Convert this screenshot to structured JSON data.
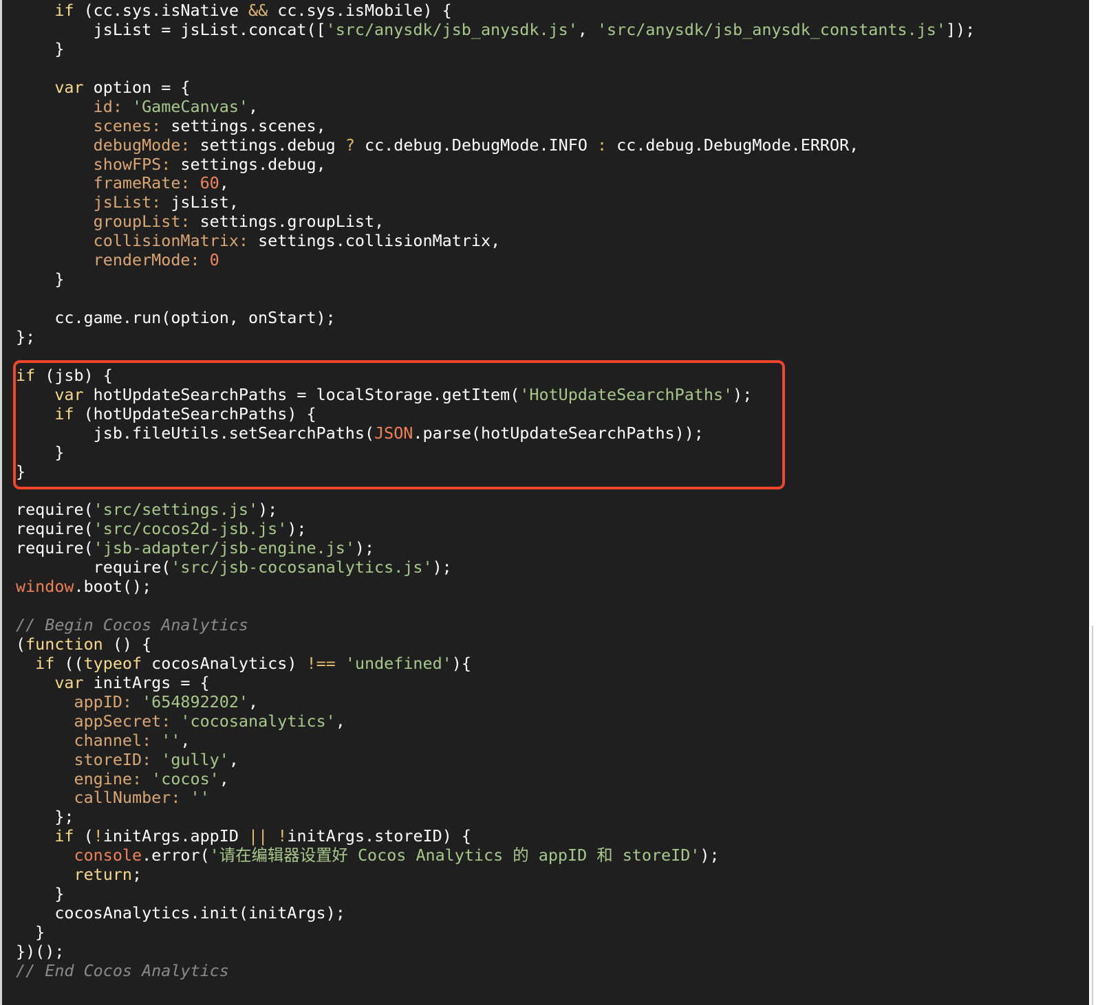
{
  "editor": {
    "theme_colors": {
      "background": "#1f1f1f",
      "keyword": "#f7d98a",
      "string": "#a8c88a",
      "property": "#d9a673",
      "number": "#f08560",
      "global": "#ef8058",
      "comment": "#8a8a8a",
      "highlight_border": "#f2452b"
    },
    "lines": [
      [
        {
          "t": "    "
        },
        {
          "t": "if",
          "c": "kw"
        },
        {
          "t": " (cc.sys.isNative "
        },
        {
          "t": "&&",
          "c": "op"
        },
        {
          "t": " cc.sys.isMobile) {"
        }
      ],
      [
        {
          "t": "        jsList = jsList.concat(["
        },
        {
          "t": "'src/anysdk/jsb_anysdk.js'",
          "c": "str"
        },
        {
          "t": ", "
        },
        {
          "t": "'src/anysdk/jsb_anysdk_constants.js'",
          "c": "str"
        },
        {
          "t": "]);"
        }
      ],
      [
        {
          "t": "    }"
        }
      ],
      [
        {
          "t": ""
        }
      ],
      [
        {
          "t": "    "
        },
        {
          "t": "var",
          "c": "kw"
        },
        {
          "t": " option = {"
        }
      ],
      [
        {
          "t": "        "
        },
        {
          "t": "id",
          "c": "prop"
        },
        {
          "t": ": ",
          "c": "prop"
        },
        {
          "t": "'GameCanvas'",
          "c": "str"
        },
        {
          "t": ","
        }
      ],
      [
        {
          "t": "        "
        },
        {
          "t": "scenes",
          "c": "prop"
        },
        {
          "t": ": ",
          "c": "prop"
        },
        {
          "t": "settings.scenes,"
        }
      ],
      [
        {
          "t": "        "
        },
        {
          "t": "debugMode",
          "c": "prop"
        },
        {
          "t": ": ",
          "c": "prop"
        },
        {
          "t": "settings.debug "
        },
        {
          "t": "?",
          "c": "op"
        },
        {
          "t": " cc.debug.DebugMode.INFO "
        },
        {
          "t": ":",
          "c": "op"
        },
        {
          "t": " cc.debug.DebugMode.ERROR,"
        }
      ],
      [
        {
          "t": "        "
        },
        {
          "t": "showFPS",
          "c": "prop"
        },
        {
          "t": ": ",
          "c": "prop"
        },
        {
          "t": "settings.debug,"
        }
      ],
      [
        {
          "t": "        "
        },
        {
          "t": "frameRate",
          "c": "prop"
        },
        {
          "t": ": ",
          "c": "prop"
        },
        {
          "t": "60",
          "c": "num"
        },
        {
          "t": ","
        }
      ],
      [
        {
          "t": "        "
        },
        {
          "t": "jsList",
          "c": "prop"
        },
        {
          "t": ": ",
          "c": "prop"
        },
        {
          "t": "jsList,"
        }
      ],
      [
        {
          "t": "        "
        },
        {
          "t": "groupList",
          "c": "prop"
        },
        {
          "t": ": ",
          "c": "prop"
        },
        {
          "t": "settings.groupList,"
        }
      ],
      [
        {
          "t": "        "
        },
        {
          "t": "collisionMatrix",
          "c": "prop"
        },
        {
          "t": ": ",
          "c": "prop"
        },
        {
          "t": "settings.collisionMatrix,"
        }
      ],
      [
        {
          "t": "        "
        },
        {
          "t": "renderMode",
          "c": "prop"
        },
        {
          "t": ": ",
          "c": "prop"
        },
        {
          "t": "0",
          "c": "num"
        }
      ],
      [
        {
          "t": "    }"
        }
      ],
      [
        {
          "t": ""
        }
      ],
      [
        {
          "t": "    cc.game.run(option, onStart);"
        }
      ],
      [
        {
          "t": "};"
        }
      ],
      [
        {
          "t": ""
        }
      ],
      [
        {
          "t": "if",
          "c": "kw"
        },
        {
          "t": " (jsb) {"
        }
      ],
      [
        {
          "t": "    "
        },
        {
          "t": "var",
          "c": "kw"
        },
        {
          "t": " hotUpdateSearchPaths = localStorage.getItem("
        },
        {
          "t": "'HotUpdateSearchPaths'",
          "c": "str"
        },
        {
          "t": ");"
        }
      ],
      [
        {
          "t": "    "
        },
        {
          "t": "if",
          "c": "kw"
        },
        {
          "t": " (hotUpdateSearchPaths) {"
        }
      ],
      [
        {
          "t": "        jsb.fileUtils.setSearchPaths("
        },
        {
          "t": "JSON",
          "c": "glob"
        },
        {
          "t": ".parse(hotUpdateSearchPaths));"
        }
      ],
      [
        {
          "t": "    }"
        }
      ],
      [
        {
          "t": "}"
        }
      ],
      [
        {
          "t": ""
        }
      ],
      [
        {
          "t": "require("
        },
        {
          "t": "'src/settings.js'",
          "c": "str"
        },
        {
          "t": ");"
        }
      ],
      [
        {
          "t": "require("
        },
        {
          "t": "'src/cocos2d-jsb.js'",
          "c": "str"
        },
        {
          "t": ");"
        }
      ],
      [
        {
          "t": "require("
        },
        {
          "t": "'jsb-adapter/jsb-engine.js'",
          "c": "str"
        },
        {
          "t": ");"
        }
      ],
      [
        {
          "t": "        require("
        },
        {
          "t": "'src/jsb-cocosanalytics.js'",
          "c": "str"
        },
        {
          "t": ");"
        }
      ],
      [
        {
          "t": "window",
          "c": "glob"
        },
        {
          "t": ".boot();"
        }
      ],
      [
        {
          "t": ""
        }
      ],
      [
        {
          "t": "// Begin Cocos Analytics",
          "c": "cmt"
        }
      ],
      [
        {
          "t": "("
        },
        {
          "t": "function",
          "c": "kw"
        },
        {
          "t": " () {"
        }
      ],
      [
        {
          "t": "  "
        },
        {
          "t": "if",
          "c": "kw"
        },
        {
          "t": " (("
        },
        {
          "t": "typeof",
          "c": "kw"
        },
        {
          "t": " cocosAnalytics) "
        },
        {
          "t": "!==",
          "c": "op"
        },
        {
          "t": " "
        },
        {
          "t": "'undefined'",
          "c": "str"
        },
        {
          "t": "){"
        }
      ],
      [
        {
          "t": "    "
        },
        {
          "t": "var",
          "c": "kw"
        },
        {
          "t": " initArgs = {"
        }
      ],
      [
        {
          "t": "      "
        },
        {
          "t": "appID",
          "c": "prop"
        },
        {
          "t": ": ",
          "c": "prop"
        },
        {
          "t": "'654892202'",
          "c": "str"
        },
        {
          "t": ","
        }
      ],
      [
        {
          "t": "      "
        },
        {
          "t": "appSecret",
          "c": "prop"
        },
        {
          "t": ": ",
          "c": "prop"
        },
        {
          "t": "'cocosanalytics'",
          "c": "str"
        },
        {
          "t": ","
        }
      ],
      [
        {
          "t": "      "
        },
        {
          "t": "channel",
          "c": "prop"
        },
        {
          "t": ": ",
          "c": "prop"
        },
        {
          "t": "''",
          "c": "str"
        },
        {
          "t": ","
        }
      ],
      [
        {
          "t": "      "
        },
        {
          "t": "storeID",
          "c": "prop"
        },
        {
          "t": ": ",
          "c": "prop"
        },
        {
          "t": "'gully'",
          "c": "str"
        },
        {
          "t": ","
        }
      ],
      [
        {
          "t": "      "
        },
        {
          "t": "engine",
          "c": "prop"
        },
        {
          "t": ": ",
          "c": "prop"
        },
        {
          "t": "'cocos'",
          "c": "str"
        },
        {
          "t": ","
        }
      ],
      [
        {
          "t": "      "
        },
        {
          "t": "callNumber",
          "c": "prop"
        },
        {
          "t": ": ",
          "c": "prop"
        },
        {
          "t": "''",
          "c": "str"
        }
      ],
      [
        {
          "t": "    };"
        }
      ],
      [
        {
          "t": "    "
        },
        {
          "t": "if",
          "c": "kw"
        },
        {
          "t": " ("
        },
        {
          "t": "!",
          "c": "op"
        },
        {
          "t": "initArgs.appID "
        },
        {
          "t": "||",
          "c": "op"
        },
        {
          "t": " "
        },
        {
          "t": "!",
          "c": "op"
        },
        {
          "t": "initArgs.storeID) {"
        }
      ],
      [
        {
          "t": "      "
        },
        {
          "t": "console",
          "c": "glob"
        },
        {
          "t": ".error("
        },
        {
          "t": "'请在编辑器设置好 Cocos Analytics 的 appID 和 storeID'",
          "c": "str"
        },
        {
          "t": ");"
        }
      ],
      [
        {
          "t": "      "
        },
        {
          "t": "return",
          "c": "kw"
        },
        {
          "t": ";"
        }
      ],
      [
        {
          "t": "    }"
        }
      ],
      [
        {
          "t": "    cocosAnalytics.init(initArgs);"
        }
      ],
      [
        {
          "t": "  }"
        }
      ],
      [
        {
          "t": "})();"
        }
      ],
      [
        {
          "t": "// End Cocos Analytics",
          "c": "cmt"
        }
      ]
    ]
  }
}
